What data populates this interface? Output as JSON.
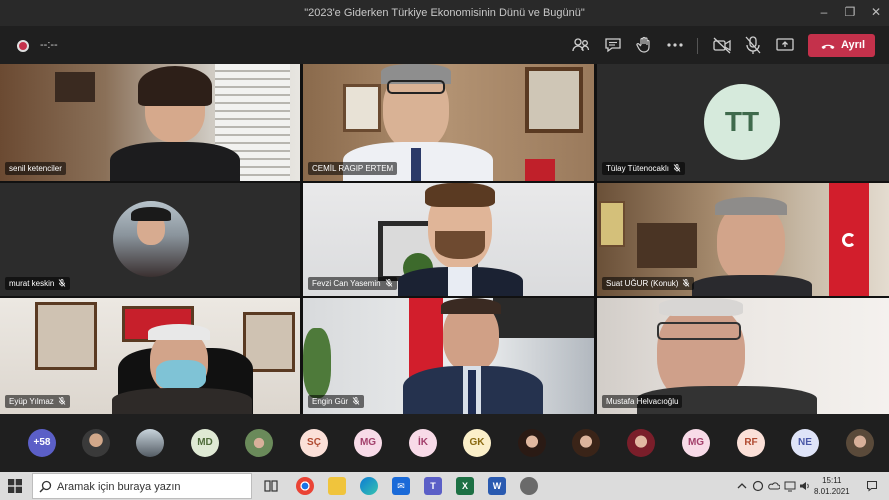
{
  "window": {
    "title": "\"2023'e Giderken Türkiye Ekonomisinin Dünü ve Bugünü\""
  },
  "toolbar": {
    "timer": "--:--",
    "leave_label": "Ayrıl"
  },
  "tiles": [
    {
      "name": "senil ketenciler"
    },
    {
      "name": "CEMİL RAGIP ERTEM"
    },
    {
      "name": "Tülay Tütenocaklı",
      "initials": "TT"
    },
    {
      "name": "murat keskin"
    },
    {
      "name": "Fevzi Can Yasemin"
    },
    {
      "name": "Suat UĞUR (Konuk)"
    },
    {
      "name": "Eyüp Yılmaz"
    },
    {
      "name": "Engin Gür"
    },
    {
      "name": "Mustafa Helvacıoğlu"
    }
  ],
  "participants": {
    "overflow": "+58",
    "avatars": [
      "",
      "",
      "MD",
      "",
      "SÇ",
      "MG",
      "İK",
      "GK",
      "",
      "",
      "",
      "MG",
      "RF",
      "NE",
      ""
    ]
  },
  "taskbar": {
    "search_placeholder": "Aramak için buraya yazın",
    "time": "15:11",
    "date": "8.01.2021"
  }
}
